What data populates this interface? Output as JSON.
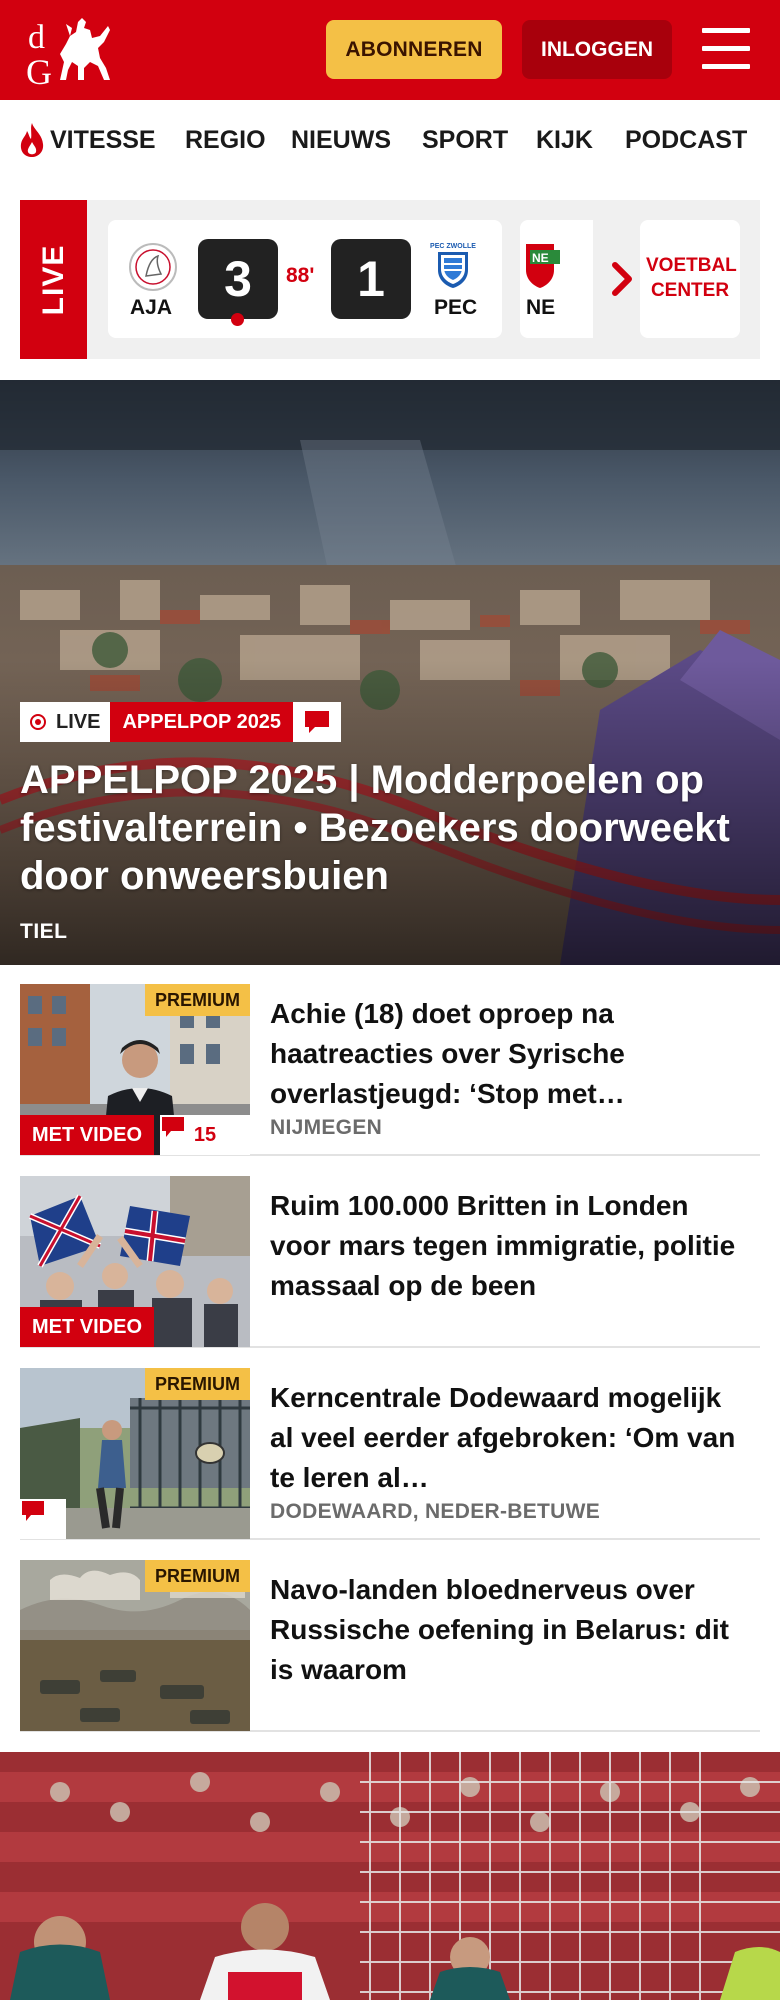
{
  "header": {
    "logo_text": "dG",
    "subscribe_label": "ABONNEREN",
    "login_label": "INLOGGEN",
    "brand_color": "#d2000f"
  },
  "nav": {
    "items": [
      {
        "label": "VITESSE",
        "icon": "flame-icon"
      },
      {
        "label": "REGIO"
      },
      {
        "label": "NIEUWS"
      },
      {
        "label": "SPORT"
      },
      {
        "label": "KIJK"
      },
      {
        "label": "PODCAST"
      }
    ]
  },
  "live_scores": {
    "live_label": "LIVE",
    "match": {
      "home": "AJA",
      "home_score": "3",
      "minute": "88'",
      "away_score": "1",
      "away": "PEC"
    },
    "next_match_partial": "NE",
    "voetbal_center_label": "VOETBAL CENTER"
  },
  "hero": {
    "live_badge": "LIVE",
    "topic": "APPELPOP 2025",
    "title": "APPELPOP 2025 | Modderpoelen op festivalterrein • Bezoekers doorweekt door onweersbuien",
    "location": "TIEL"
  },
  "articles": [
    {
      "premium": "PREMIUM",
      "video_label": "MET VIDEO",
      "comments": "15",
      "title": "Achie (18) doet oproep na haatreacties over Syrische overlastjeugd: ‘Stop met…",
      "location": "NIJMEGEN"
    },
    {
      "video_label": "MET VIDEO",
      "title": "Ruim 100.000 Britten in Londen voor mars tegen immigratie, politie massaal op de been"
    },
    {
      "premium": "PREMIUM",
      "title": "Kerncentrale Dodewaard mogelijk al veel eerder afgebroken: ‘Om van te leren al…",
      "location": "DODEWAARD, NEDER-BETUWE"
    },
    {
      "premium": "PREMIUM",
      "title": "Navo-landen bloednerveus over Russische oefening in Belarus: dit is waarom"
    }
  ]
}
